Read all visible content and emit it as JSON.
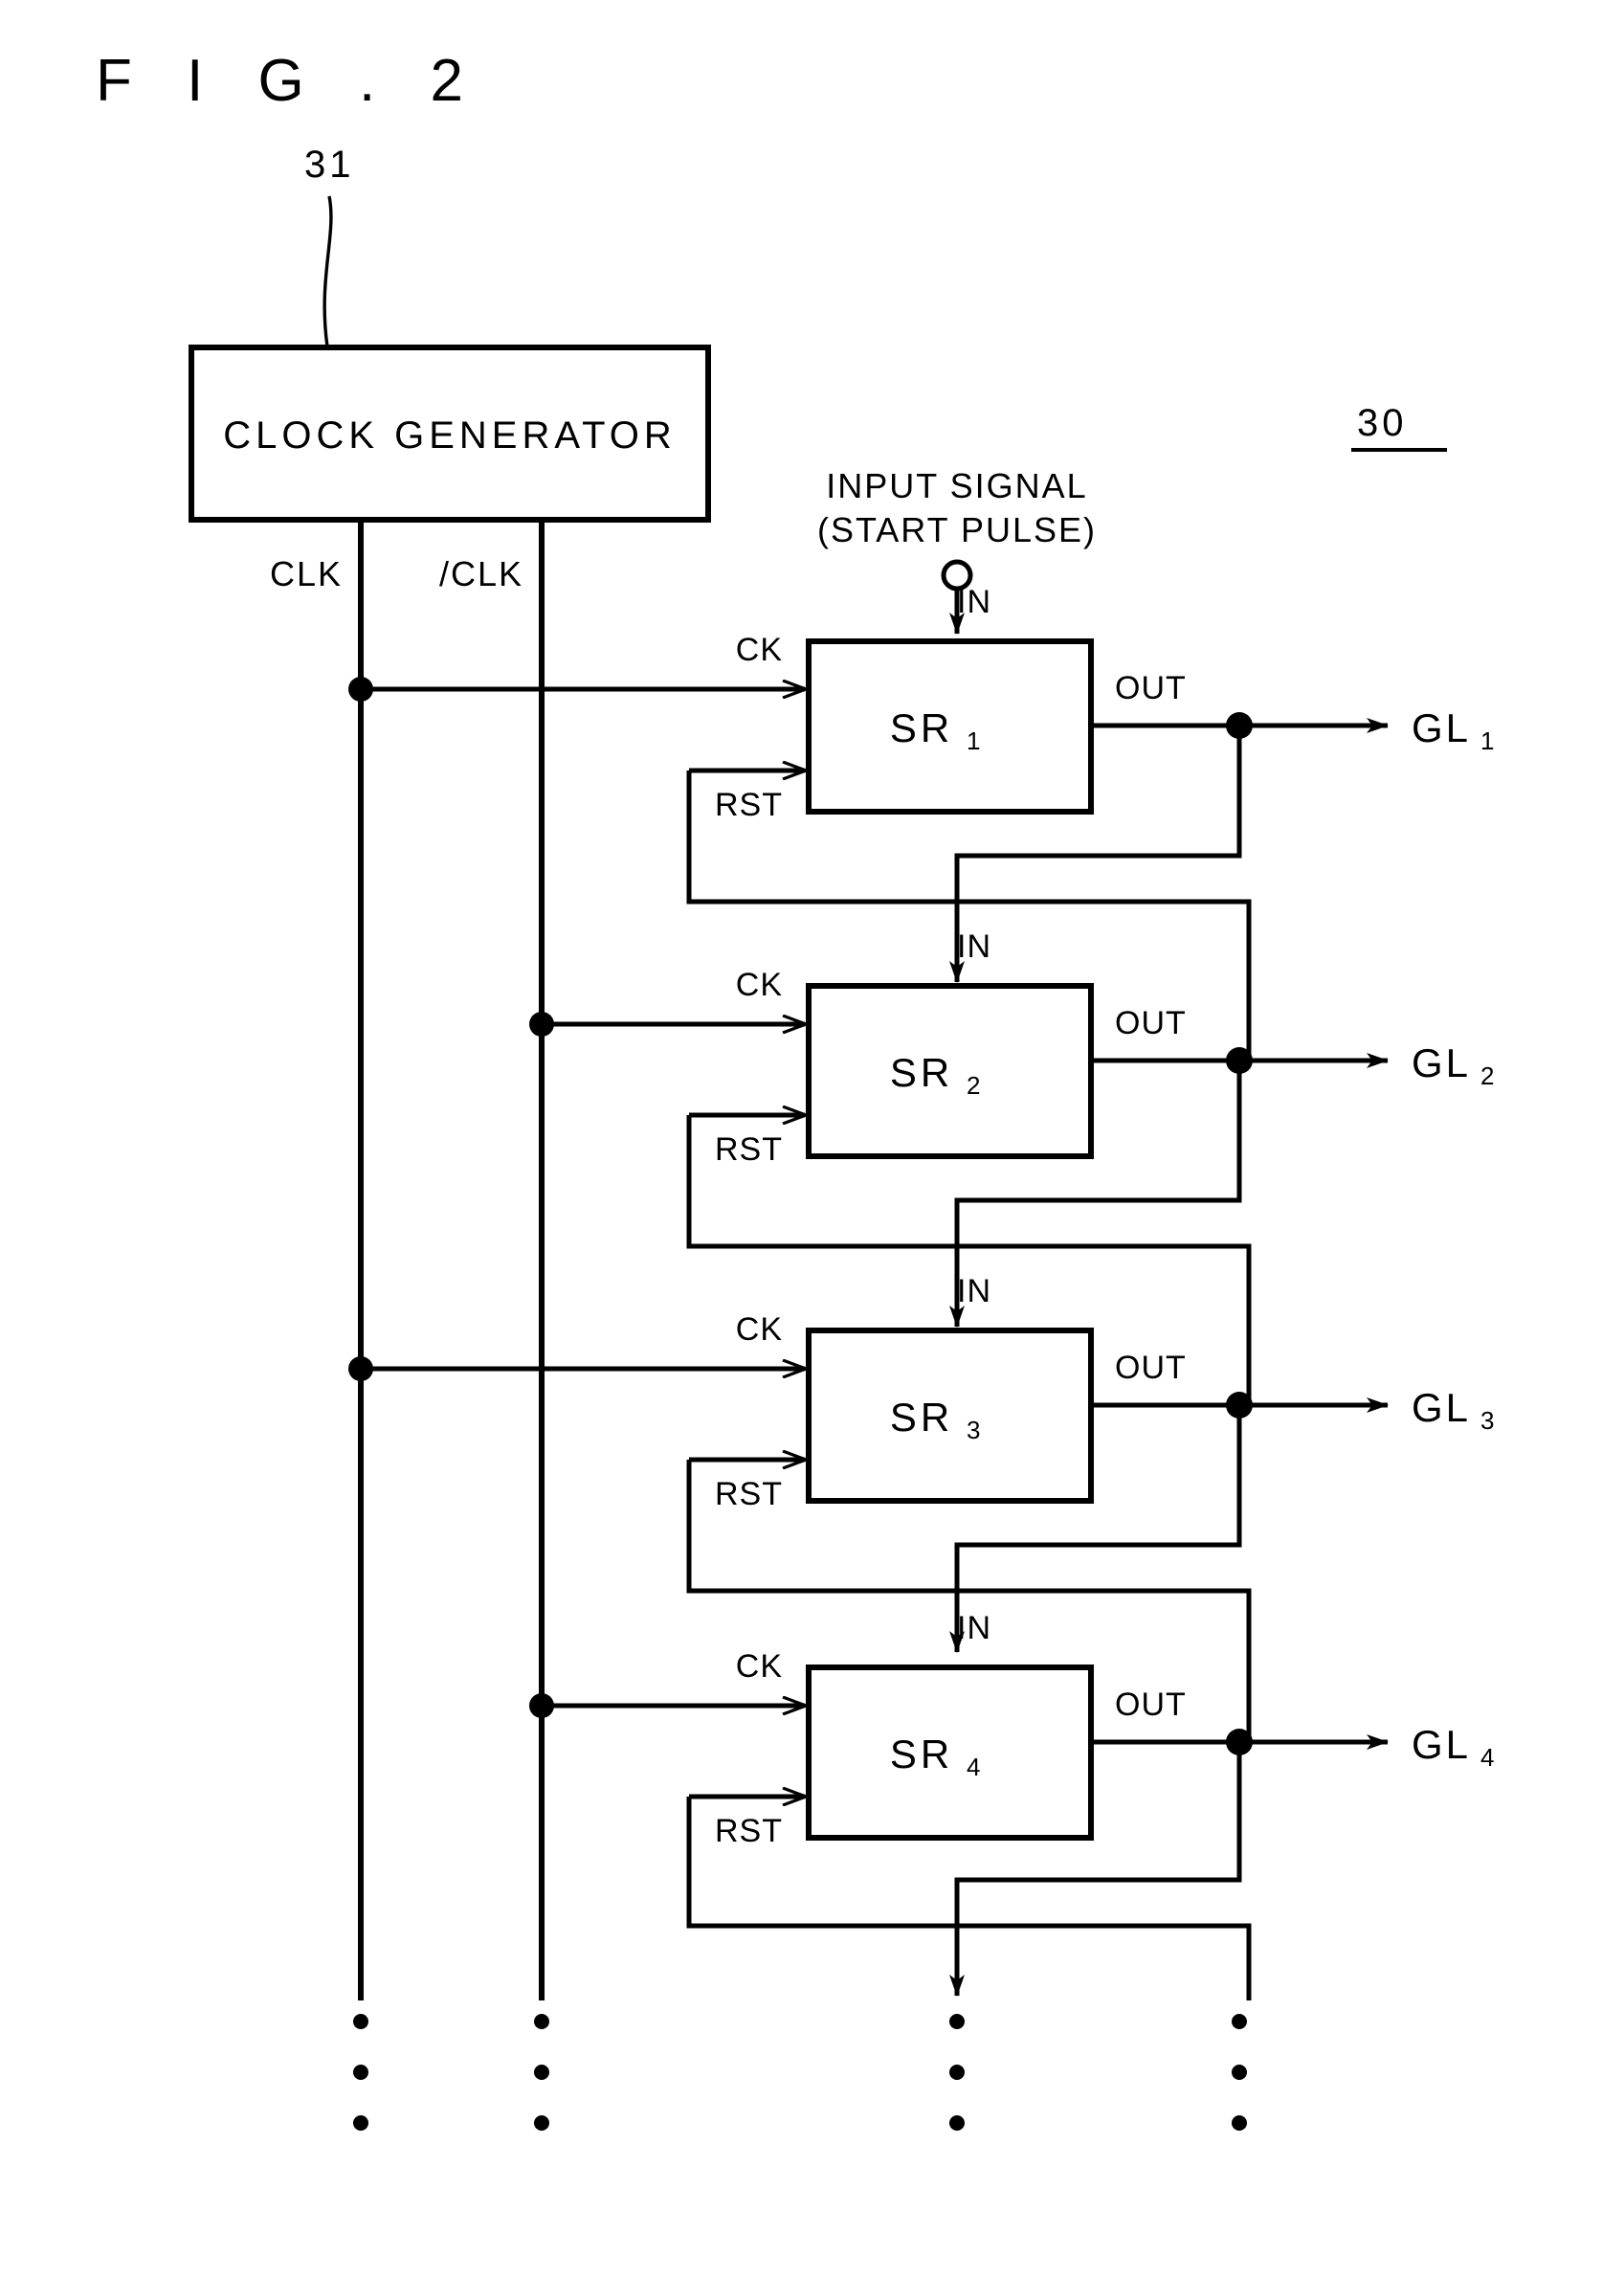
{
  "figure": {
    "title": "F I G . 2",
    "ref_main": "30",
    "ref_clock": "31"
  },
  "clock_generator": {
    "label": "CLOCK GENERATOR",
    "outputs": [
      {
        "name": "clk",
        "label": "CLK"
      },
      {
        "name": "clk_bar",
        "label": "/CLK"
      }
    ]
  },
  "input_signal": {
    "line1": "INPUT SIGNAL",
    "line2": "(START PULSE)",
    "terminal": "open-circle"
  },
  "pins": {
    "in": "IN",
    "ck": "CK",
    "rst": "RST",
    "out": "OUT"
  },
  "stages": [
    {
      "name": "SR",
      "index": "1",
      "output_label": "GL",
      "output_index": "1",
      "clock_source": "CLK"
    },
    {
      "name": "SR",
      "index": "2",
      "output_label": "GL",
      "output_index": "2",
      "clock_source": "/CLK"
    },
    {
      "name": "SR",
      "index": "3",
      "output_label": "GL",
      "output_index": "3",
      "clock_source": "CLK"
    },
    {
      "name": "SR",
      "index": "4",
      "output_label": "GL",
      "output_index": "4",
      "clock_source": "/CLK"
    }
  ],
  "continuation": {
    "symbol": "vertical-ellipsis",
    "columns": 4
  },
  "colors": {
    "ink": "#000000",
    "paper": "#ffffff"
  }
}
